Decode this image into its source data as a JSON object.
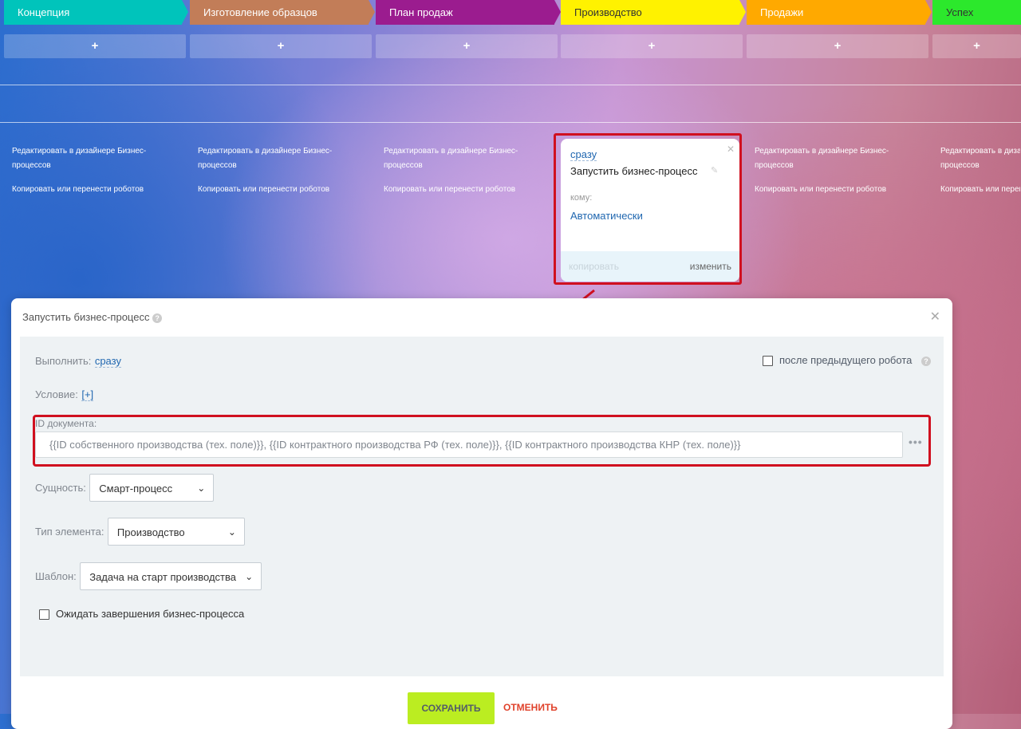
{
  "stages": [
    {
      "label": "Концепция",
      "color": "#00c4bb"
    },
    {
      "label": "Изготовление образцов",
      "color": "#c27d58"
    },
    {
      "label": "План продаж",
      "color": "#9b1c8f"
    },
    {
      "label": "Производство",
      "color": "#fff200"
    },
    {
      "label": "Продажи",
      "color": "#ffa900"
    },
    {
      "label": "Успех",
      "color": "#2ce82c"
    }
  ],
  "add_label": "+",
  "column_links": {
    "edit": "Редактировать в дизайнере Бизнес-процессов",
    "copy": "Копировать или перенести роботов"
  },
  "robot_card": {
    "when": "сразу",
    "title": "Запустить бизнес-процесс",
    "to_label": "кому:",
    "to_value": "Автоматически",
    "copy": "копировать",
    "edit": "изменить"
  },
  "modal": {
    "title": "Запустить бизнес-процесс",
    "exec_label": "Выполнить:",
    "exec_value": "сразу",
    "after_prev": "после предыдущего робота",
    "cond_label": "Условие:",
    "cond_value": "[+]",
    "doc_id_label": "ID документа:",
    "doc_id_value": "{{ID собственного производства (тех. поле)}}, {{ID контрактного производства РФ (тех. поле)}}, {{ID контрактного производства КНР (тех. поле)}}",
    "entity_label": "Сущность:",
    "entity_value": "Смарт-процесс",
    "type_label": "Тип элемента:",
    "type_value": "Производство",
    "template_label": "Шаблон:",
    "template_value": "Задача на старт производства",
    "wait_label": "Ожидать завершения бизнес-процесса",
    "save": "СОХРАНИТЬ",
    "cancel": "ОТМЕНИТЬ"
  }
}
